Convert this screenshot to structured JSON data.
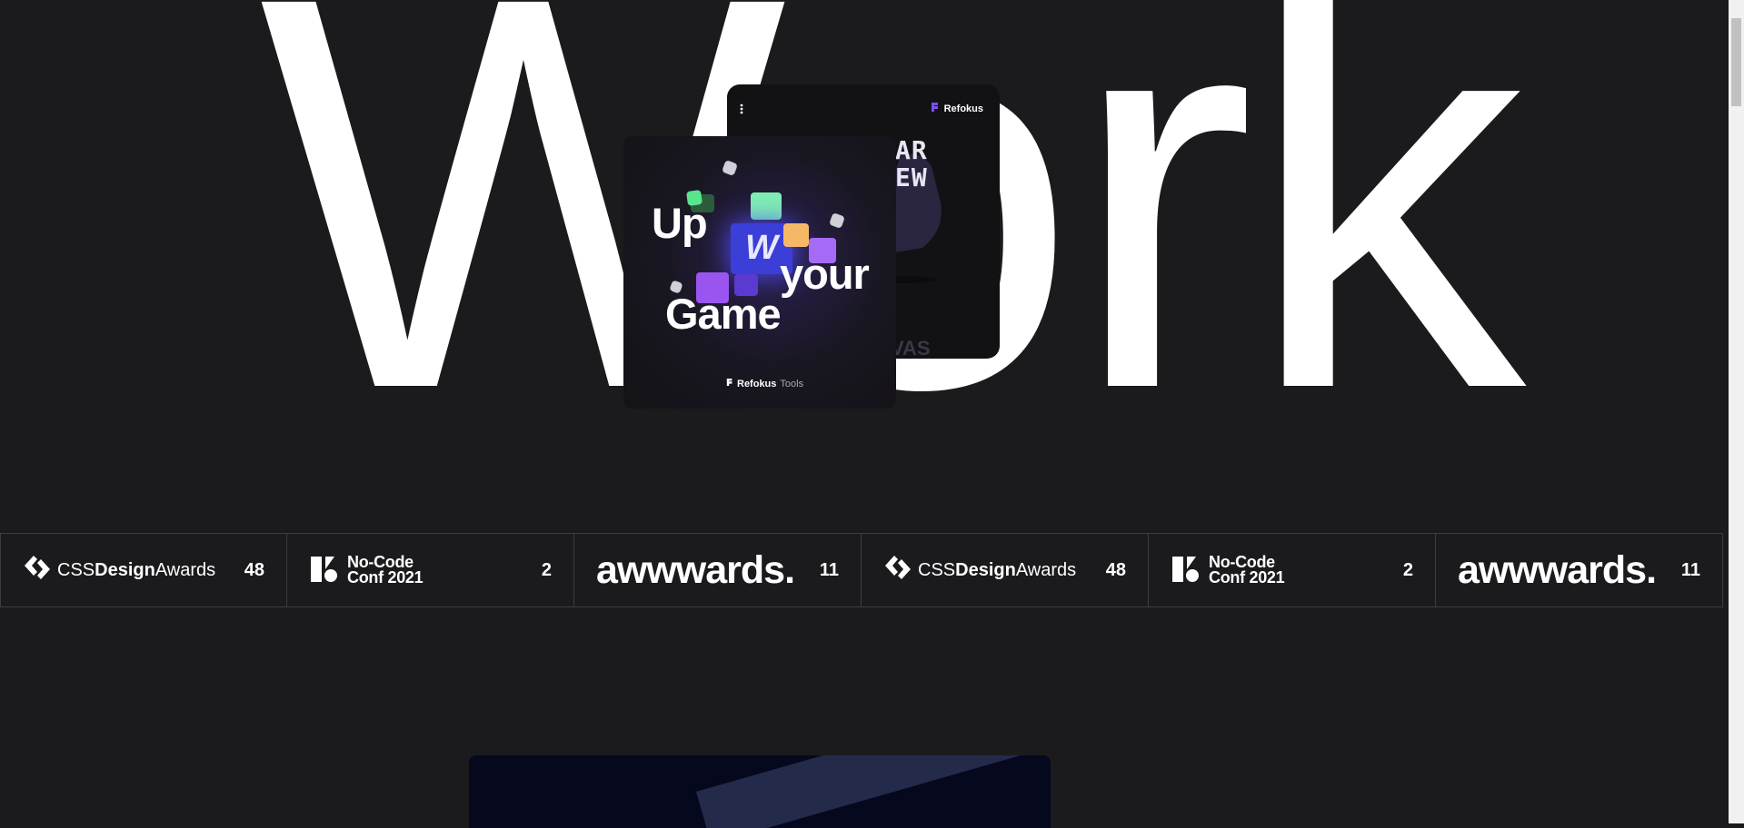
{
  "hero": {
    "title": "Work"
  },
  "card_back": {
    "brand": "Refokus",
    "pixel_text": [
      "AR",
      "EW"
    ],
    "footer_text": "VAS"
  },
  "card_front": {
    "headline_top": "Up",
    "headline_right": "your",
    "headline_bottom": "Game",
    "brand": "Refokus",
    "brand_suffix": "Tools",
    "badge": "W"
  },
  "awards": [
    {
      "type": "css",
      "brand_light1": "CSS",
      "brand_bold": "Design",
      "brand_light2": "Awards",
      "count": "48"
    },
    {
      "type": "nocode",
      "line1": "No-Code",
      "line2": "Conf 2021",
      "count": "2"
    },
    {
      "type": "awwwards",
      "brand": "awwwards.",
      "count": "11"
    },
    {
      "type": "css",
      "brand_light1": "CSS",
      "brand_bold": "Design",
      "brand_light2": "Awards",
      "count": "48"
    },
    {
      "type": "nocode",
      "line1": "No-Code",
      "line2": "Conf 2021",
      "count": "2"
    },
    {
      "type": "awwwards",
      "brand": "awwwards.",
      "count": "11"
    }
  ],
  "colors": {
    "background": "#1b1b1d",
    "text": "#ffffff",
    "accent": "#7b4dff",
    "border": "#3d3d40"
  }
}
